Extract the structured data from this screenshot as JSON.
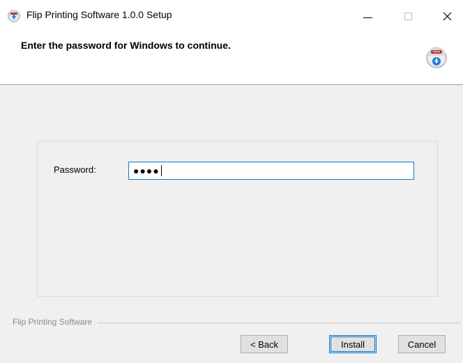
{
  "window": {
    "title": "Flip Printing Software 1.0.0 Setup",
    "icons": {
      "app": "installer-disc-icon",
      "minimize": "minimize-icon",
      "maximize": "maximize-icon",
      "close": "close-icon",
      "close_glyph": "✕"
    }
  },
  "header": {
    "title": "Enter the password for Windows to continue.",
    "logo_icon": "installer-logo-icon"
  },
  "form": {
    "password_label": "Password:",
    "password_masked": "●●●●"
  },
  "footer": {
    "brand": "Flip Printing Software",
    "buttons": {
      "back": "< Back",
      "install": "Install",
      "cancel": "Cancel"
    }
  },
  "colors": {
    "accent": "#0078d7",
    "background": "#f0f0f0"
  }
}
